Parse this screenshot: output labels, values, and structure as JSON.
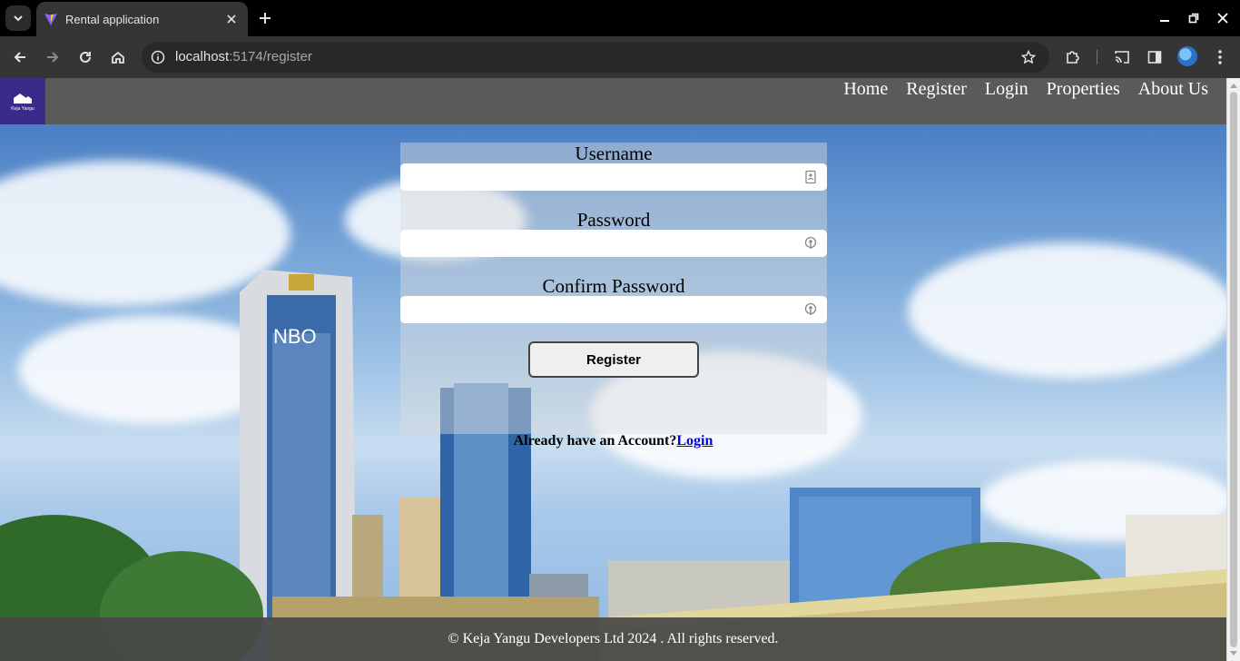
{
  "browser": {
    "tab_title": "Rental application",
    "url_host": "localhost",
    "url_rest": ":5174/register"
  },
  "site": {
    "logo_text": "Keja Yangu",
    "nav": [
      "Home",
      "Register",
      "Login",
      "Properties",
      "About Us"
    ]
  },
  "form": {
    "username_label": "Username",
    "password_label": "Password",
    "confirm_label": "Confirm Password",
    "username_value": "",
    "password_value": "",
    "confirm_value": "",
    "submit_label": "Register"
  },
  "login_prompt": {
    "text": "Already have an Account?",
    "link": "Login"
  },
  "footer": {
    "text": "© Keja Yangu Developers Ltd 2024 . All rights reserved."
  },
  "colors": {
    "navbar": "#5a5a5a",
    "logo_bg": "#3a2a8a",
    "link": "#0000ee"
  }
}
